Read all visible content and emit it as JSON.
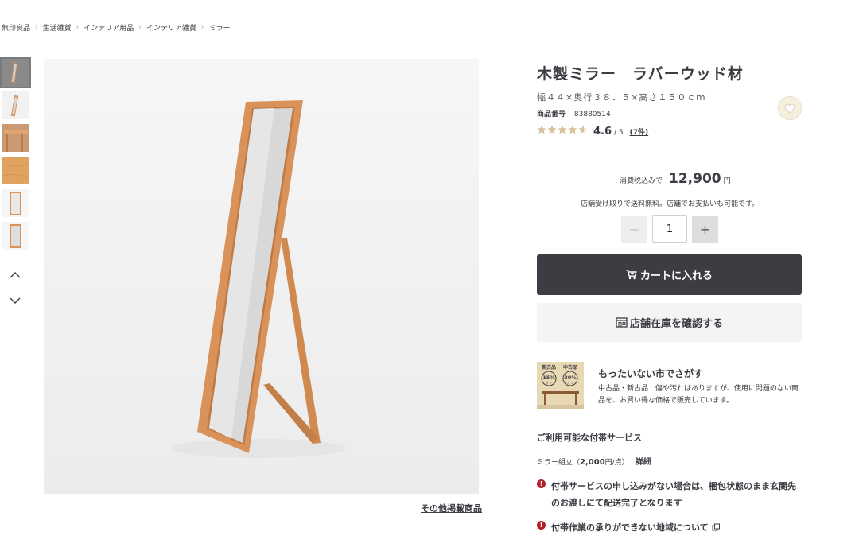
{
  "breadcrumb": {
    "items": [
      "無印良品",
      "生活雑貨",
      "インテリア用品",
      "インテリア雑貨",
      "ミラー"
    ]
  },
  "gallery": {
    "thumbnail_count": 6,
    "other_items_link": "その他掲載商品"
  },
  "product": {
    "title": "木製ミラー　ラバーウッド材",
    "size": "幅４４×奥行３８．５×高さ１５０ｃｍ",
    "number_label": "商品番号",
    "number": "83880514",
    "rating": {
      "stars": 4.6,
      "score": "4.6",
      "out_of": "/ 5",
      "reviews": "(7件)"
    },
    "price": {
      "tax_label": "消費税込みで",
      "amount": "12,900",
      "currency": "円"
    },
    "shipping_note": "店舗受け取りで送料無料。店舗でお支払いも可能です。",
    "quantity": "1"
  },
  "buttons": {
    "minus": "−",
    "plus": "+",
    "cart": "カートに入れる",
    "store_stock": "店舗在庫を確認する"
  },
  "used_section": {
    "banner_new": "新古品",
    "banner_used": "中古品",
    "banner_off1": "15%",
    "banner_off2": "30%",
    "banner_off_word": "オフ",
    "title": "もったいない市でさがす",
    "description": "中古品・新古品　傷や汚れはありますが、使用に問題のない商品を、お買い得な価格で販売しています。"
  },
  "services": {
    "title": "ご利用可能な付帯サービス",
    "item_label": "ミラー組立（",
    "item_price": "2,000",
    "item_unit": "円/点）",
    "detail_link": "詳細",
    "notices": [
      "付帯サービスの申し込みがない場合は、梱包状態のまま玄関先のお渡しにて配送完了となります",
      "付帯作業の承りができない地域について"
    ]
  },
  "colors": {
    "primary": "#3c3c43",
    "wood": "#d9935a",
    "star": "#d6c19a",
    "alert": "#b3202a",
    "banner": "#e9d8b4"
  }
}
